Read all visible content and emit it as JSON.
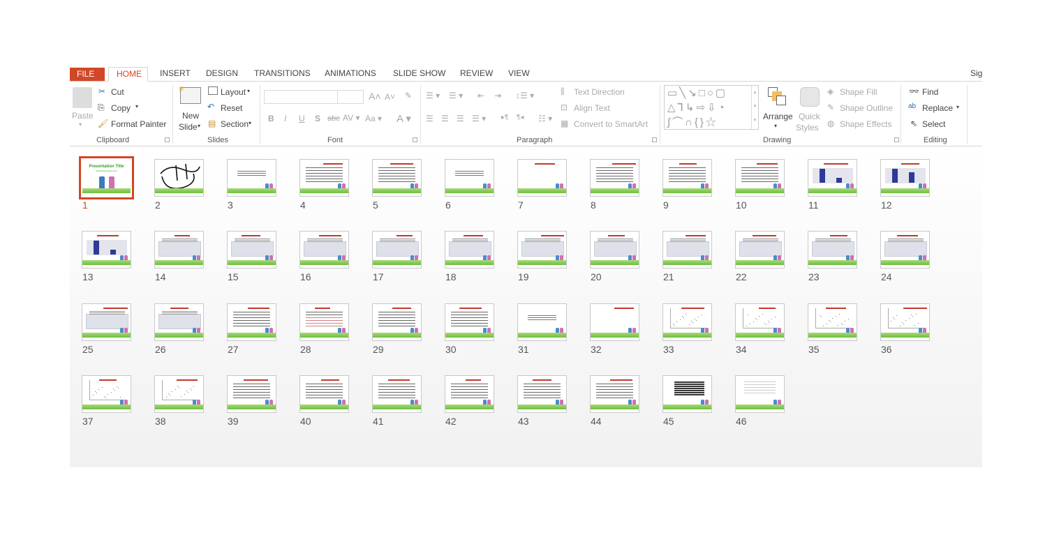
{
  "tabs": [
    "FILE",
    "HOME",
    "INSERT",
    "DESIGN",
    "TRANSITIONS",
    "ANIMATIONS",
    "SLIDE SHOW",
    "REVIEW",
    "VIEW"
  ],
  "active_tab": "HOME",
  "account_label": "Sig",
  "clipboard": {
    "paste": "Paste",
    "cut": "Cut",
    "copy": "Copy",
    "format_painter": "Format Painter",
    "label": "Clipboard"
  },
  "slides_group": {
    "new_slide_1": "New",
    "new_slide_2": "Slide",
    "layout": "Layout",
    "reset": "Reset",
    "section": "Section",
    "label": "Slides"
  },
  "font": {
    "family_value": "",
    "size_value": "",
    "label": "Font"
  },
  "paragraph": {
    "text_direction": "Text Direction",
    "align_text": "Align Text",
    "convert_smartart": "Convert to SmartArt",
    "label": "Paragraph"
  },
  "drawing": {
    "arrange": "Arrange",
    "quick_styles_1": "Quick",
    "quick_styles_2": "Styles",
    "shape_fill": "Shape Fill",
    "shape_outline": "Shape Outline",
    "shape_effects": "Shape Effects",
    "label": "Drawing"
  },
  "editing": {
    "find": "Find",
    "replace": "Replace",
    "select": "Select",
    "label": "Editing"
  },
  "colors": {
    "accent": "#d24726",
    "footer_green": "#6bbf3c",
    "title_red": "#c0392b"
  },
  "selected_slide": 1,
  "slide1": {
    "title": "Presentation Title",
    "subtitle": "Subheading goes here"
  },
  "slides": [
    "1",
    "2",
    "3",
    "4",
    "5",
    "6",
    "7",
    "8",
    "9",
    "10",
    "11",
    "12",
    "13",
    "14",
    "15",
    "16",
    "17",
    "18",
    "19",
    "20",
    "21",
    "22",
    "23",
    "24",
    "25",
    "26",
    "27",
    "28",
    "29",
    "30",
    "31",
    "32",
    "33",
    "34",
    "35",
    "36",
    "37",
    "38",
    "39",
    "40",
    "41",
    "42",
    "43",
    "44",
    "45",
    "46"
  ]
}
